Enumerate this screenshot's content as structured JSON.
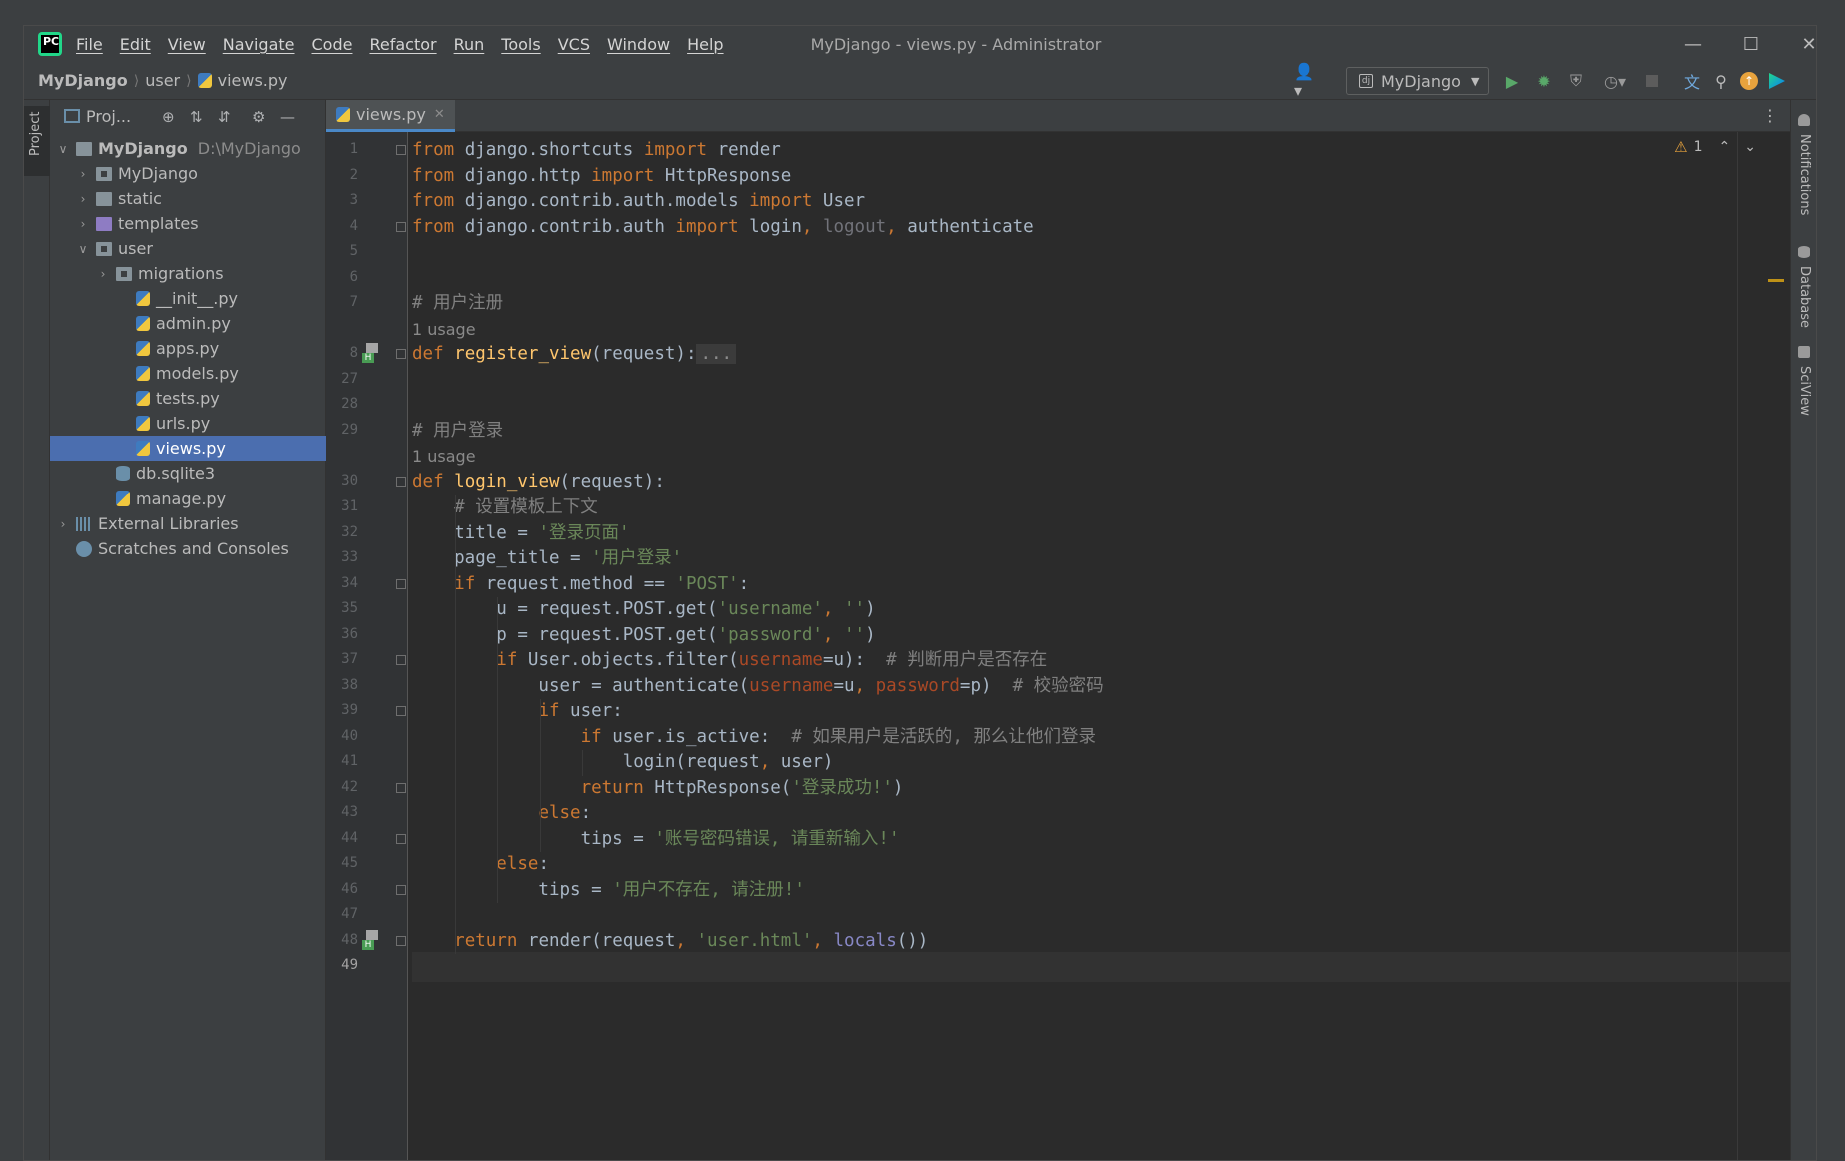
{
  "app": {
    "logo_text": "PC",
    "window_title": "MyDjango - views.py - Administrator"
  },
  "menu": [
    "File",
    "Edit",
    "View",
    "Navigate",
    "Code",
    "Refactor",
    "Run",
    "Tools",
    "VCS",
    "Window",
    "Help"
  ],
  "breadcrumb": {
    "project": "MyDjango",
    "folder": "user",
    "file": "views.py"
  },
  "toolbar": {
    "run_config": "MyDjango",
    "icons": [
      "user-icon",
      "run-icon",
      "debug-icon",
      "coverage-icon",
      "profile-icon",
      "stop-icon",
      "translate-icon",
      "search-icon",
      "update-icon",
      "plugin-icon"
    ]
  },
  "left_strip": {
    "project_tab": "Project"
  },
  "project_panel": {
    "title": "Proj...",
    "tree": [
      {
        "label": "MyDjango",
        "hint": "D:\\MyDjango",
        "depth": 0,
        "arrow": "down",
        "icon": "folder"
      },
      {
        "label": "MyDjango",
        "depth": 1,
        "arrow": "right",
        "icon": "folder-pkg"
      },
      {
        "label": "static",
        "depth": 1,
        "arrow": "right",
        "icon": "folder"
      },
      {
        "label": "templates",
        "depth": 1,
        "arrow": "right",
        "icon": "folder-purple"
      },
      {
        "label": "user",
        "depth": 1,
        "arrow": "down",
        "icon": "folder-pkg"
      },
      {
        "label": "migrations",
        "depth": 2,
        "arrow": "right",
        "icon": "folder-pkg"
      },
      {
        "label": "__init__.py",
        "depth": 3,
        "arrow": "",
        "icon": "py"
      },
      {
        "label": "admin.py",
        "depth": 3,
        "arrow": "",
        "icon": "py"
      },
      {
        "label": "apps.py",
        "depth": 3,
        "arrow": "",
        "icon": "py"
      },
      {
        "label": "models.py",
        "depth": 3,
        "arrow": "",
        "icon": "py"
      },
      {
        "label": "tests.py",
        "depth": 3,
        "arrow": "",
        "icon": "py"
      },
      {
        "label": "urls.py",
        "depth": 3,
        "arrow": "",
        "icon": "py"
      },
      {
        "label": "views.py",
        "depth": 3,
        "arrow": "",
        "icon": "py",
        "selected": true
      },
      {
        "label": "db.sqlite3",
        "depth": 2,
        "arrow": "",
        "icon": "db"
      },
      {
        "label": "manage.py",
        "depth": 2,
        "arrow": "",
        "icon": "py"
      },
      {
        "label": "External Libraries",
        "depth": 0,
        "arrow": "right",
        "icon": "lib"
      },
      {
        "label": "Scratches and Consoles",
        "depth": 0,
        "arrow": "",
        "icon": "scratch"
      }
    ]
  },
  "editor": {
    "tab_label": "views.py",
    "inspection": {
      "warning_count": "1"
    },
    "lines": [
      {
        "no": "1",
        "html": "<span class='kw'>from</span> django.shortcuts <span class='kw'>import</span> render"
      },
      {
        "no": "2",
        "html": "<span class='kw'>from</span> django.http <span class='kw'>import</span> HttpResponse"
      },
      {
        "no": "3",
        "html": "<span class='kw'>from</span> django.contrib.auth.models <span class='kw'>import</span> User"
      },
      {
        "no": "4",
        "html": "<span class='kw'>from</span> django.contrib.auth <span class='kw'>import</span> login<span class='kw'>,</span> <span class='dim'>logout</span><span class='kw'>,</span> authenticate"
      },
      {
        "no": "5",
        "html": ""
      },
      {
        "no": "6",
        "html": ""
      },
      {
        "no": "7",
        "html": "<span class='cmt'># 用户注册</span>"
      },
      {
        "no": "",
        "html": "<span class='hint'>1 usage</span>"
      },
      {
        "no": "8",
        "html": "<span class='kw'>def</span> <span class='fn'>register_view</span>(request):<span class='folded'>...</span>"
      },
      {
        "no": "27",
        "html": ""
      },
      {
        "no": "28",
        "html": ""
      },
      {
        "no": "29",
        "html": "<span class='cmt'># 用户登录</span>"
      },
      {
        "no": "",
        "html": "<span class='hint'>1 usage</span>"
      },
      {
        "no": "30",
        "html": "<span class='kw'>def</span> <span class='fn'>login_view</span>(request):"
      },
      {
        "no": "31",
        "html": "    <span class='cmt'># 设置模板上下文</span>"
      },
      {
        "no": "32",
        "html": "    title = <span class='str'>'登录页面'</span>"
      },
      {
        "no": "33",
        "html": "    page_title = <span class='str'>'用户登录'</span>"
      },
      {
        "no": "34",
        "html": "    <span class='kw'>if</span> request.method == <span class='str'>'POST'</span>:"
      },
      {
        "no": "35",
        "html": "        u = request.POST.get(<span class='str'>'username'</span><span class='kw'>,</span> <span class='str'>''</span>)"
      },
      {
        "no": "36",
        "html": "        p = request.POST.get(<span class='str'>'password'</span><span class='kw'>,</span> <span class='str'>''</span>)"
      },
      {
        "no": "37",
        "html": "        <span class='kw'>if</span> User.objects.filter(<span class='param'>username</span>=u):  <span class='cmt'># 判断用户是否存在</span>"
      },
      {
        "no": "38",
        "html": "            user = authenticate(<span class='param'>username</span>=u<span class='kw'>,</span> <span class='param'>password</span>=p)  <span class='cmt'># 校验密码</span>"
      },
      {
        "no": "39",
        "html": "            <span class='kw'>if</span> user:"
      },
      {
        "no": "40",
        "html": "                <span class='kw'>if</span> user.is_active:  <span class='cmt'># 如果用户是活跃的, 那么让他们登录</span>"
      },
      {
        "no": "41",
        "html": "                    login(request<span class='kw'>,</span> user)"
      },
      {
        "no": "42",
        "html": "                <span class='kw'>return</span> HttpResponse(<span class='str'>'登录成功!'</span>)"
      },
      {
        "no": "43",
        "html": "            <span class='kw'>else</span>:"
      },
      {
        "no": "44",
        "html": "                tips = <span class='str'>'账号密码错误, 请重新输入!'</span>"
      },
      {
        "no": "45",
        "html": "        <span class='kw'>else</span>:"
      },
      {
        "no": "46",
        "html": "            tips = <span class='str'>'用户不存在, 请注册!'</span>"
      },
      {
        "no": "47",
        "html": ""
      },
      {
        "no": "48",
        "html": "    <span class='kw'>return</span> render(request<span class='kw'>,</span> <span class='str'>'user.html'</span><span class='kw'>,</span> <span class='builtin'>locals</span>())"
      },
      {
        "no": "49",
        "html": ""
      }
    ]
  },
  "right_strip": {
    "tabs": [
      "Notifications",
      "Database",
      "SciView"
    ]
  }
}
